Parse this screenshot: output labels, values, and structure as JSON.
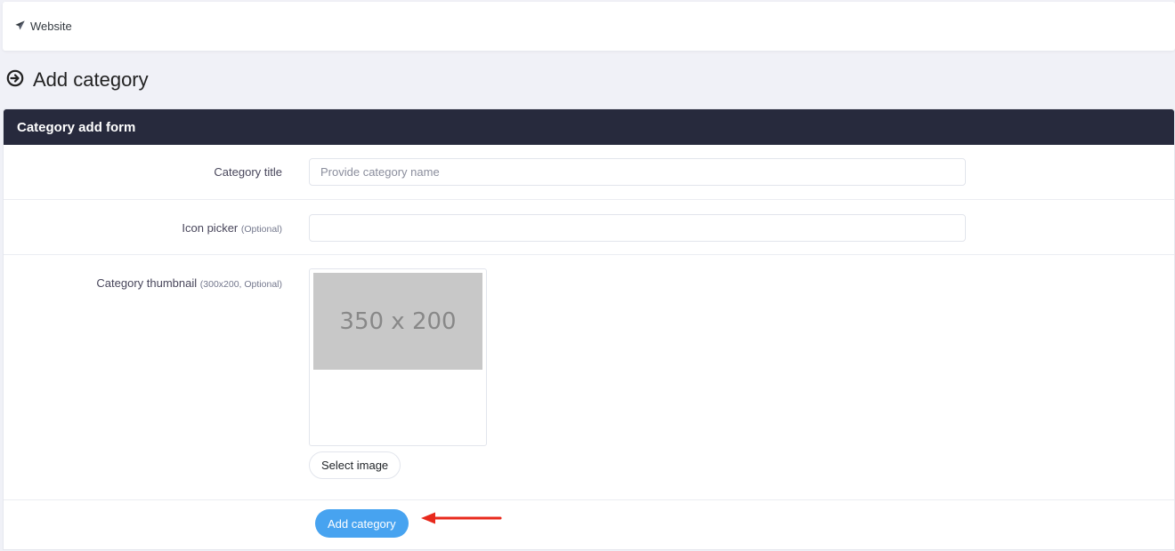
{
  "topbar": {
    "link_label": "Website",
    "link_icon": "paper-plane-icon"
  },
  "page": {
    "title": "Add category",
    "title_icon": "circle-arrow-right-icon"
  },
  "card": {
    "header": "Category add form"
  },
  "form": {
    "title_label": "Category title",
    "title_placeholder": "Provide category name",
    "title_value": "",
    "icon_label": "Icon picker",
    "icon_hint": "(Optional)",
    "icon_value": "",
    "thumb_label": "Category thumbnail",
    "thumb_hint": "(300x200, Optional)",
    "thumb_placeholder_text": "350 x 200",
    "select_image_label": "Select image",
    "submit_label": "Add category"
  },
  "annotation": {
    "arrow_color": "#e8291c",
    "arrow_icon": "arrow-left-icon"
  },
  "colors": {
    "card_header_bg": "#272a3d",
    "primary_button": "#47a3f0",
    "page_bg": "#f0f1f7"
  }
}
